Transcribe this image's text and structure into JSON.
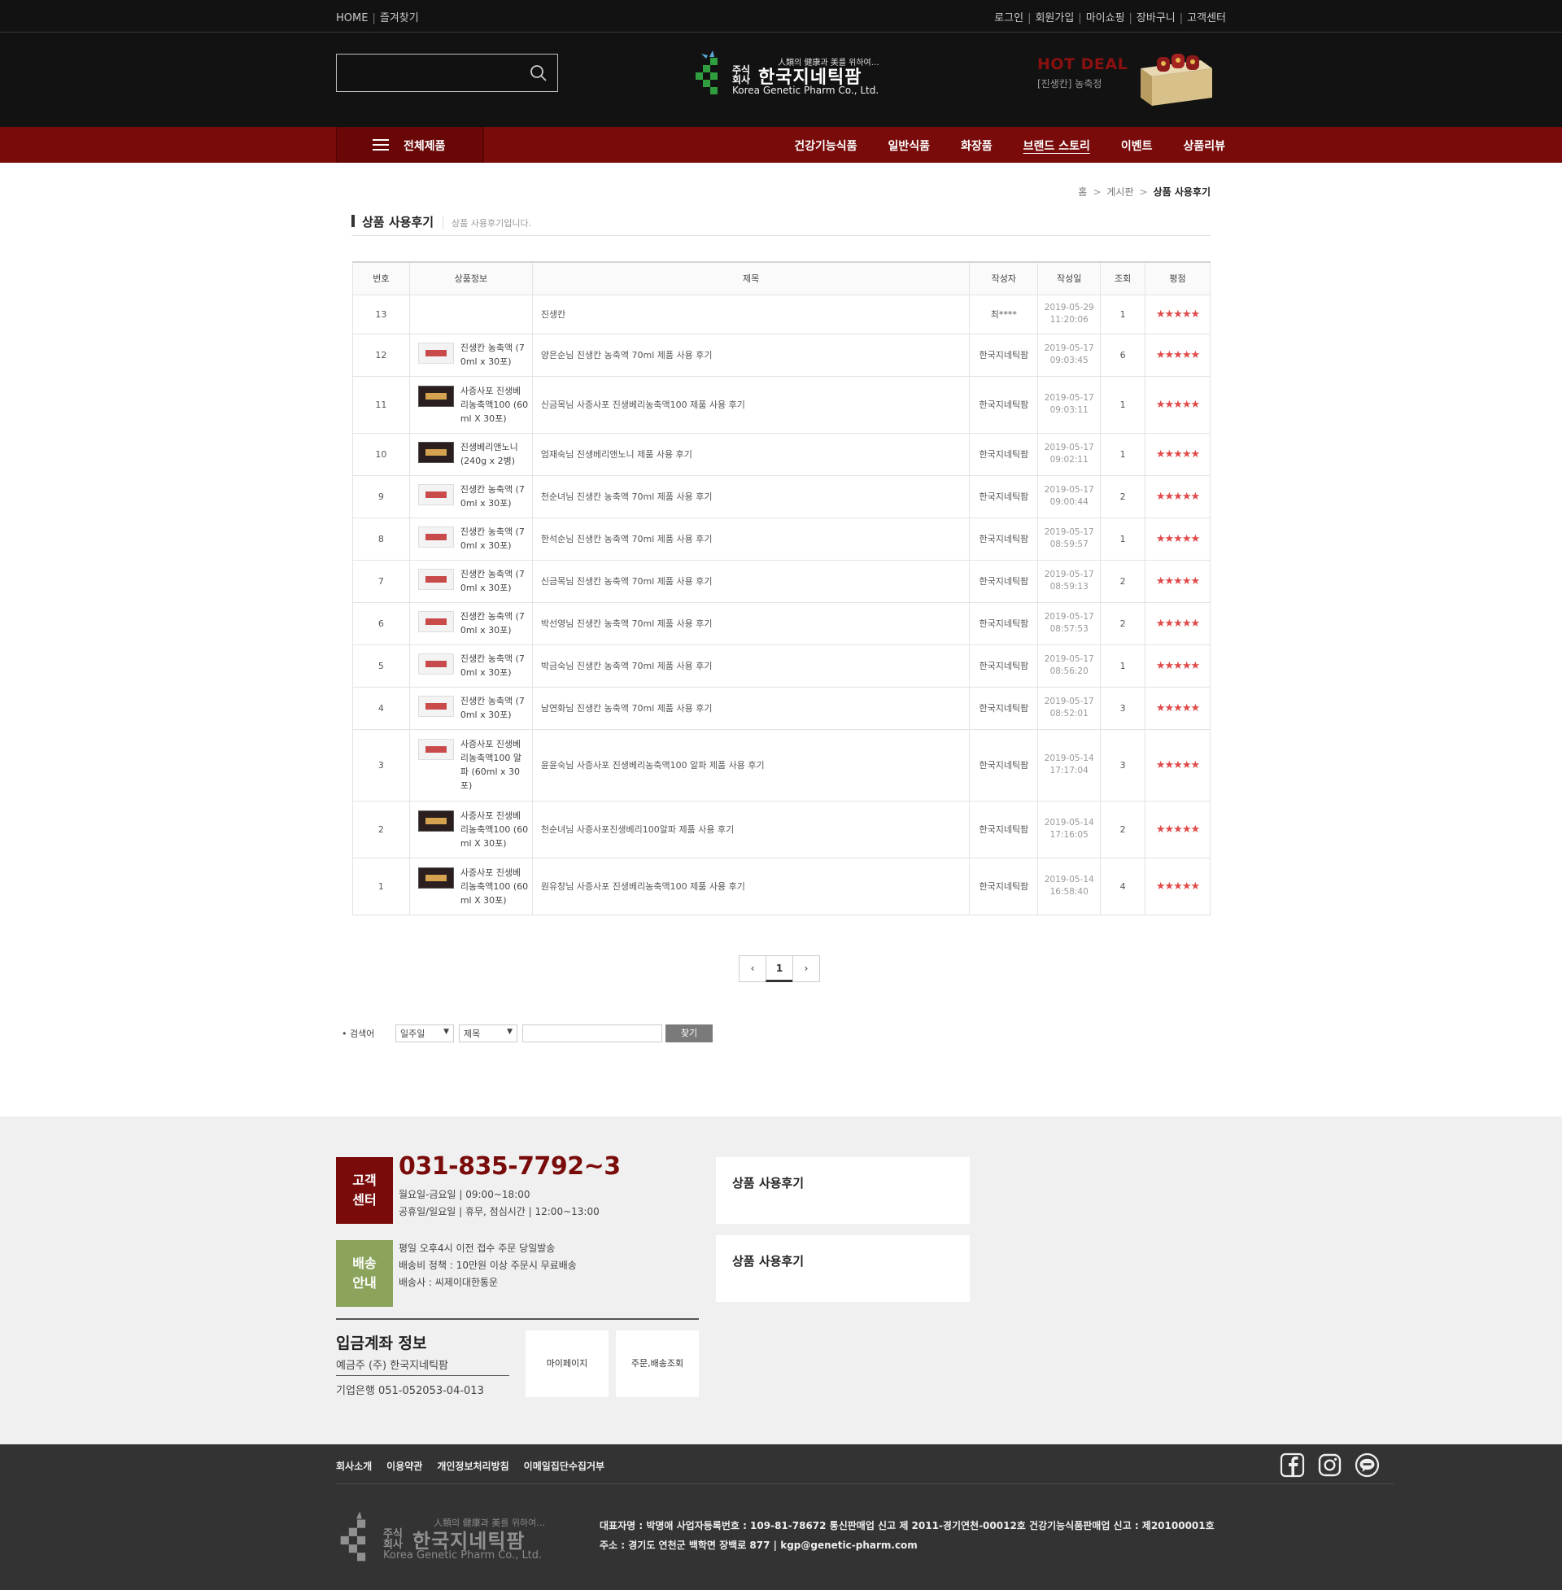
{
  "topbar": {
    "left": [
      "HOME",
      "즐겨찾기"
    ],
    "right": [
      "로그인",
      "회원가입",
      "마이쇼핑",
      "장바구니",
      "고객센터"
    ]
  },
  "header": {
    "search_placeholder": "",
    "logo": {
      "slogan": "人類의 健康과 美를 위하여…",
      "jusik": "주식",
      "hoesa": "회사",
      "name": "한국지네틱팜",
      "english": "Korea Genetic Pharm Co., Ltd."
    },
    "hotdeal": {
      "title": "HOT DEAL",
      "subtitle": "[진생칸] 농축정"
    }
  },
  "nav": {
    "all_label": "전체제품",
    "items": [
      "건강기능식품",
      "일반식품",
      "화장품",
      "브랜드 스토리",
      "이벤트",
      "상품리뷰"
    ]
  },
  "breadcrumb": {
    "home": "홈",
    "board": "게시판",
    "current": "상품 사용후기"
  },
  "page": {
    "title": "상품 사용후기",
    "description": "상품 사용후기입니다."
  },
  "table": {
    "headers": [
      "번호",
      "상품정보",
      "제목",
      "작성자",
      "작성일",
      "조회",
      "평점"
    ],
    "stars": "★★★★★",
    "rows": [
      {
        "no": "13",
        "product": "",
        "thumb": "none",
        "subject": "진생칸",
        "author": "최****",
        "date": "2019-05-29",
        "time": "11:20:06",
        "views": "1"
      },
      {
        "no": "12",
        "product": "진생칸 농축액 (70ml x 30포)",
        "thumb": "light",
        "subject": "양은순님 진생칸 농축액 70ml 제품 사용 후기",
        "author": "한국지네틱팜",
        "date": "2019-05-17",
        "time": "09:03:45",
        "views": "6"
      },
      {
        "no": "11",
        "product": "사증사포 진생베리농축액100 (60ml X 30포)",
        "thumb": "dark",
        "subject": "신금목님 사증사포 진생베리농축액100 제품 사용 후기",
        "author": "한국지네틱팜",
        "date": "2019-05-17",
        "time": "09:03:11",
        "views": "1"
      },
      {
        "no": "10",
        "product": "진생베리앤노니 (240g x 2병)",
        "thumb": "dark",
        "subject": "엄재숙님 진생베리앤노니 제품 사용 후기",
        "author": "한국지네틱팜",
        "date": "2019-05-17",
        "time": "09:02:11",
        "views": "1"
      },
      {
        "no": "9",
        "product": "진생칸 농축액 (70ml x 30포)",
        "thumb": "light",
        "subject": "천순녀님 진생칸 농축액 70ml 제품 사용 후기",
        "author": "한국지네틱팜",
        "date": "2019-05-17",
        "time": "09:00:44",
        "views": "2"
      },
      {
        "no": "8",
        "product": "진생칸 농축액 (70ml x 30포)",
        "thumb": "light",
        "subject": "한석순님 진생칸 농축액 70ml 제품 사용 후기",
        "author": "한국지네틱팜",
        "date": "2019-05-17",
        "time": "08:59:57",
        "views": "1"
      },
      {
        "no": "7",
        "product": "진생칸 농축액 (70ml x 30포)",
        "thumb": "light",
        "subject": "신금목님 진생칸 농축액 70ml 제품 사용 후기",
        "author": "한국지네틱팜",
        "date": "2019-05-17",
        "time": "08:59:13",
        "views": "2"
      },
      {
        "no": "6",
        "product": "진생칸 농축액 (70ml x 30포)",
        "thumb": "light",
        "subject": "박선영님 진생칸 농축액 70ml 제품 사용 후기",
        "author": "한국지네틱팜",
        "date": "2019-05-17",
        "time": "08:57:53",
        "views": "2"
      },
      {
        "no": "5",
        "product": "진생칸 농축액 (70ml x 30포)",
        "thumb": "light",
        "subject": "박금숙님 진생칸 농축액 70ml 제품 사용 후기",
        "author": "한국지네틱팜",
        "date": "2019-05-17",
        "time": "08:56:20",
        "views": "1"
      },
      {
        "no": "4",
        "product": "진생칸 농축액 (70ml x 30포)",
        "thumb": "light",
        "subject": "남연화님 진생칸 농축액 70ml 제품 사용 후기",
        "author": "한국지네틱팜",
        "date": "2019-05-17",
        "time": "08:52:01",
        "views": "3"
      },
      {
        "no": "3",
        "product": "사증사포 진생베리농축액100 알파 (60ml x 30포)",
        "thumb": "light",
        "subject": "윤윤숙님 사증사포 진생베리농축액100 알파 제품 사용 후기",
        "author": "한국지네틱팜",
        "date": "2019-05-14",
        "time": "17:17:04",
        "views": "3"
      },
      {
        "no": "2",
        "product": "사증사포 진생베리농축액100 (60ml X 30포)",
        "thumb": "dark",
        "subject": "천순녀님 사증사포진생베리100알파 제품 사용 후기",
        "author": "한국지네틱팜",
        "date": "2019-05-14",
        "time": "17:16:05",
        "views": "2"
      },
      {
        "no": "1",
        "product": "사증사포 진생베리농축액100 (60ml X 30포)",
        "thumb": "dark",
        "subject": "원유창님 사증사포 진생베리농축액100 제품 사용 후기",
        "author": "한국지네틱팜",
        "date": "2019-05-14",
        "time": "16:58:40",
        "views": "4"
      }
    ]
  },
  "pagination": {
    "prev": "‹",
    "current": "1",
    "next": "›"
  },
  "search": {
    "label": "• 검색어",
    "period": "일주일",
    "field": "제목",
    "button": "찾기"
  },
  "footer": {
    "cs_label_1": "고객",
    "cs_label_2": "센터",
    "phone": "031-835-7792~3",
    "hours_1": "월요일-금요일 | 09:00~18:00",
    "hours_2": "공휴일/일요일 | 휴무, 점심시간 | 12:00~13:00",
    "ship_label_1": "배송",
    "ship_label_2": "안내",
    "ship_1": "평일 오후4시 이전 접수 주문 당일발송",
    "ship_2": "배송비 정책 : 10만원 이상 주문시 무료배송",
    "ship_3": "배송사 : 씨제이대한통운",
    "account_title": "입금계좌 정보",
    "account_owner": "예금주 (주) 한국지네틱팜",
    "account_number": "기업은행 051-052053-04-013",
    "mypage": "마이페이지",
    "order": "주문,배송조회",
    "board1": "상품 사용후기",
    "board2": "상품 사용후기"
  },
  "bottom": {
    "links": [
      "회사소개",
      "이용약관",
      "개인정보처리방침",
      "이메일집단수집거부"
    ],
    "info_1": "대표자명 : 박명애 사업자등록번호 : 109-81-78672 통신판매업 신고 제 2011-경기연천-00012호 건강기능식품판매업 신고 : 제20100001호",
    "info_2": "주소 : 경기도 연천군 백학면 장백로 877 | kgp@genetic-pharm.com",
    "logo": {
      "slogan": "人類의 健康과 美를 위하여…",
      "jusik": "주식",
      "hoesa": "회사",
      "name": "한국지네틱팜",
      "english": "Korea Genetic Pharm Co., Ltd."
    }
  },
  "colors": {
    "brand_red": "#7a0b0b",
    "delivery_green": "#8ba35b",
    "star": "#e04a4a"
  }
}
